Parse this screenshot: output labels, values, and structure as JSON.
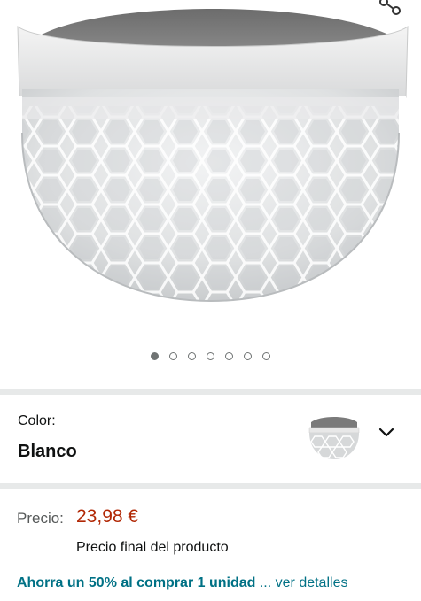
{
  "image_gallery": {
    "dot_count": 7,
    "active_index": 0
  },
  "color_selector": {
    "label": "Color:",
    "value": "Blanco"
  },
  "price": {
    "label": "Precio:",
    "value": "23,98 €",
    "note": "Precio final del producto"
  },
  "promo": {
    "offer_text": "Ahorra un 50% al comprar 1 unidad",
    "details_link": "... ver detalles"
  },
  "colors": {
    "price": "#b12704",
    "link": "#007185",
    "divider": "#e7e9e9"
  }
}
